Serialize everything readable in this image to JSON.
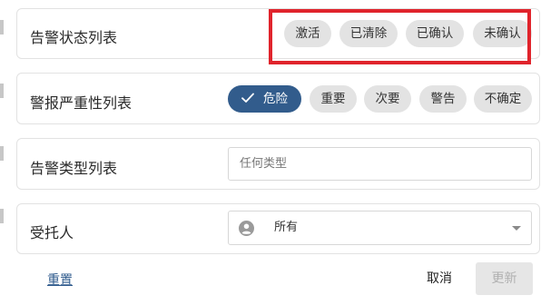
{
  "filters": {
    "alert_status": {
      "label": "告警状态列表",
      "options": [
        "激活",
        "已清除",
        "已确认",
        "未确认"
      ]
    },
    "alarm_severity": {
      "label": "警报严重性列表",
      "selected": "危险",
      "options": [
        "危险",
        "重要",
        "次要",
        "警告",
        "不确定"
      ]
    },
    "alert_type": {
      "label": "告警类型列表",
      "placeholder": "任何类型"
    },
    "assignee": {
      "label": "受托人",
      "value": "所有"
    }
  },
  "footer": {
    "reset_label": "重置",
    "cancel_label": "取消",
    "update_label": "更新"
  },
  "colors": {
    "accent": "#325c8c",
    "highlight": "#e0242c",
    "chip_bg": "#e3e3e3"
  },
  "icons": {
    "check": "check-icon",
    "user": "user-circle-icon",
    "dropdown": "chevron-down-icon"
  }
}
